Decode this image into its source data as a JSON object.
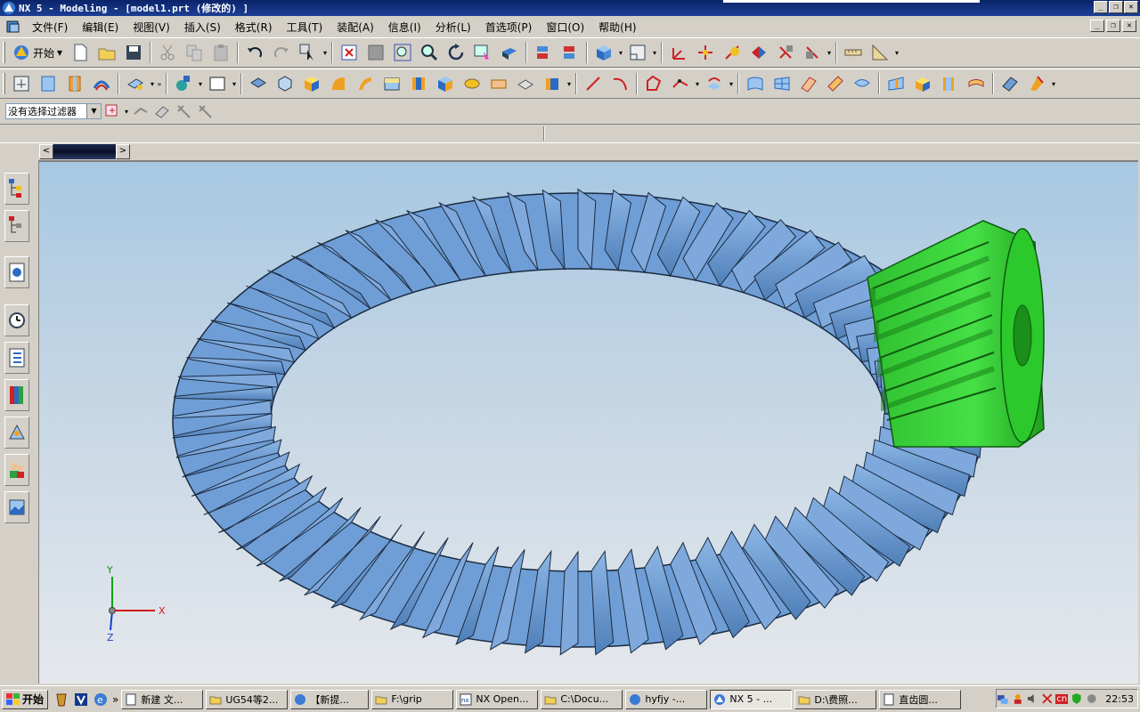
{
  "window": {
    "title": "NX 5 - Modeling - [model1.prt (修改的) ]",
    "minimize_glyph": "_",
    "restore_glyph": "❐",
    "close_glyph": "✕"
  },
  "menubar": {
    "items": [
      "文件(F)",
      "编辑(E)",
      "视图(V)",
      "插入(S)",
      "格式(R)",
      "工具(T)",
      "装配(A)",
      "信息(I)",
      "分析(L)",
      "首选项(P)",
      "窗口(O)",
      "帮助(H)"
    ]
  },
  "toolbar": {
    "start_label": "开始",
    "overflow_glyph": "»"
  },
  "selection_bar": {
    "filter_value": "没有选择过滤器"
  },
  "view_tabs": {
    "left_arrow": "<",
    "right_arrow": ">"
  },
  "graphics": {
    "axis_labels": {
      "x": "X",
      "y": "Y",
      "z": "Z"
    },
    "colors": {
      "ring_gear": "#6f9ed6",
      "pinion": "#38d438",
      "background_top": "#a8c8e2",
      "background_bottom": "#e5e8ec"
    }
  },
  "taskbar": {
    "start_label": "开始",
    "overflow_glyph": "»",
    "buttons": [
      {
        "label": "新建 文...",
        "icon": "notepad-icon",
        "active": false
      },
      {
        "label": "UG54等2...",
        "icon": "folder-icon",
        "active": false
      },
      {
        "label": "【新提...",
        "icon": "ie-icon",
        "active": false
      },
      {
        "label": "F:\\grip",
        "icon": "folder-icon",
        "active": false
      },
      {
        "label": "NX Open...",
        "icon": "nx-icon",
        "active": false
      },
      {
        "label": "C:\\Docu...",
        "icon": "folder-icon",
        "active": false
      },
      {
        "label": "hyfjy -...",
        "icon": "ie-icon",
        "active": false
      },
      {
        "label": "NX 5 - ...",
        "icon": "nx-icon",
        "active": true
      },
      {
        "label": "D:\\费照...",
        "icon": "folder-icon",
        "active": false
      },
      {
        "label": "直齿圆...",
        "icon": "notepad-icon",
        "active": false
      }
    ],
    "clock": "22:53",
    "tray_ime": "cn"
  }
}
